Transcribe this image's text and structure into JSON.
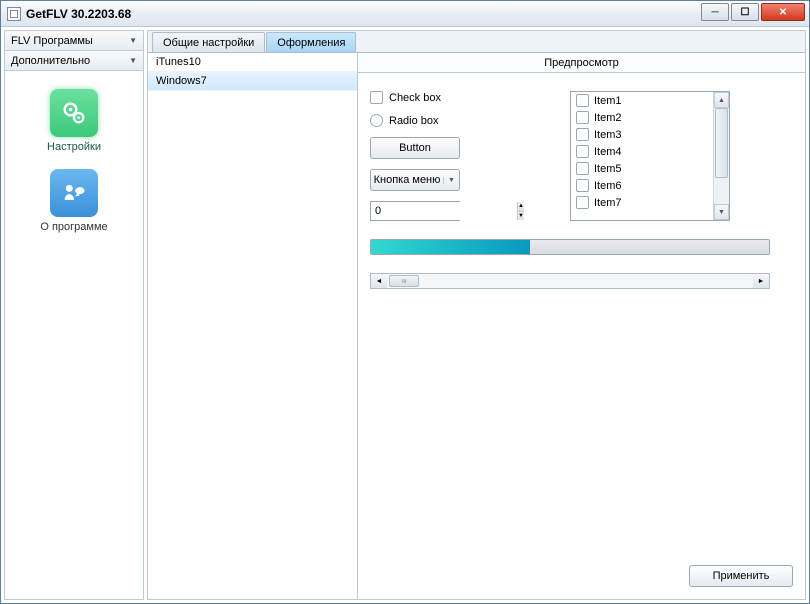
{
  "window": {
    "title": "GetFLV 30.2203.68"
  },
  "sidebar": {
    "header1": "FLV Программы",
    "header2": "Дополнительно",
    "item_settings": "Настройки",
    "item_about": "О программе"
  },
  "tabs": {
    "general": "Общие настройки",
    "themes": "Оформления"
  },
  "themes": {
    "items": [
      "iTunes10",
      "Windows7"
    ]
  },
  "preview": {
    "title": "Предпросмотр",
    "checkbox_label": "Check box",
    "radio_label": "Radio box",
    "button_label": "Button",
    "menu_label": "Кнопка меню",
    "spinner_value": "0",
    "list_items": [
      "Item1",
      "Item2",
      "Item3",
      "Item4",
      "Item5",
      "Item6",
      "Item7"
    ]
  },
  "actions": {
    "apply": "Применить"
  }
}
